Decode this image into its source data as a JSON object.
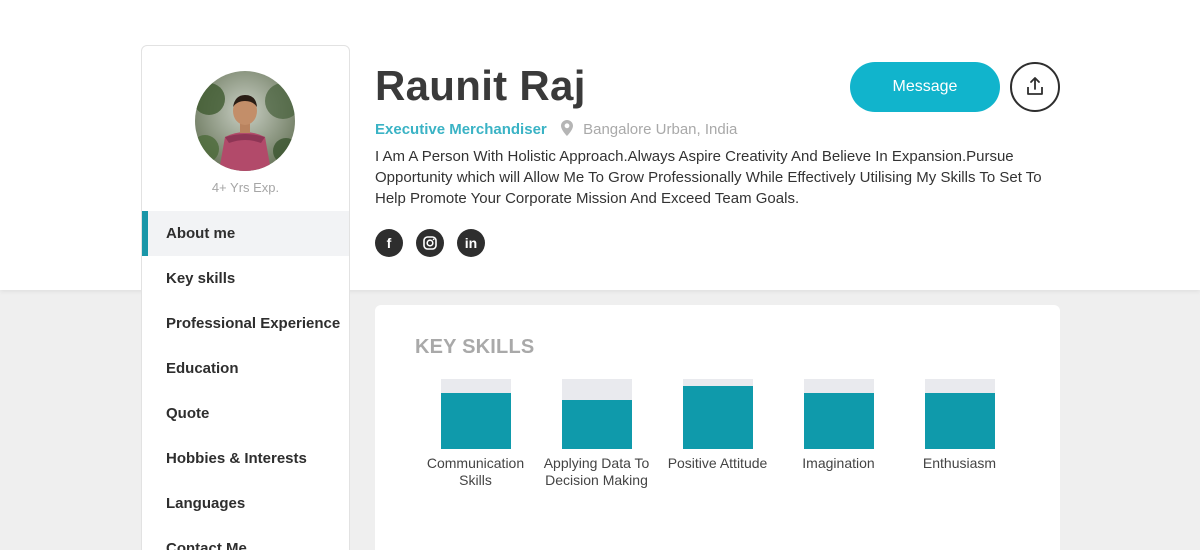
{
  "profile": {
    "name": "Raunit Raj",
    "job_title": "Executive Merchandiser",
    "location": "Bangalore Urban, India",
    "bio": "I Am A Person With Holistic Approach.Always Aspire Creativity And Believe In Expansion.Pursue Opportunity which will Allow Me To Grow Professionally While Effectively Utilising My Skills To Set To Help Promote Your Corporate Mission And Exceed Team Goals.",
    "experience": "4+ Yrs Exp."
  },
  "actions": {
    "message_label": "Message",
    "share_icon": "share-icon"
  },
  "socials": [
    {
      "name": "facebook-icon",
      "glyph": "f"
    },
    {
      "name": "instagram-icon",
      "glyph": ""
    },
    {
      "name": "linkedin-icon",
      "glyph": "in"
    }
  ],
  "sidebar": {
    "items": [
      {
        "label": "About me",
        "active": true
      },
      {
        "label": "Key skills"
      },
      {
        "label": "Professional Experience"
      },
      {
        "label": "Education"
      },
      {
        "label": "Quote"
      },
      {
        "label": "Hobbies & Interests"
      },
      {
        "label": "Languages"
      },
      {
        "label": "Contact Me"
      }
    ]
  },
  "key_skills": {
    "heading": "KEY SKILLS",
    "skills": [
      {
        "label": "Communication Skills",
        "level": 0.8
      },
      {
        "label": "Applying Data To Decision Making",
        "level": 0.7
      },
      {
        "label": "Positive Attitude",
        "level": 0.9
      },
      {
        "label": "Imagination",
        "level": 0.8
      },
      {
        "label": "Enthusiasm",
        "level": 0.8
      }
    ]
  },
  "colors": {
    "accent": "#11b4cc",
    "skill_fill": "#0f9aab",
    "active_bar": "#1996a8",
    "job_title": "#3ab3c5"
  }
}
